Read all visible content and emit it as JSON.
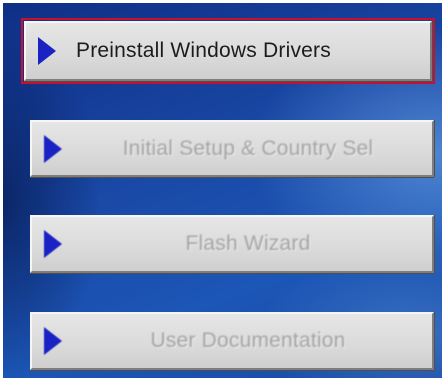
{
  "menu": {
    "buttons": [
      {
        "label": "Preinstall Windows Drivers",
        "state": "active",
        "icon": "play-arrow-icon"
      },
      {
        "label": "Initial Setup & Country Sel",
        "state": "disabled",
        "icon": "play-arrow-icon"
      },
      {
        "label": "Flash Wizard",
        "state": "disabled",
        "icon": "play-arrow-icon"
      },
      {
        "label": "User Documentation",
        "state": "disabled",
        "icon": "play-arrow-icon"
      }
    ]
  },
  "colors": {
    "background": "#1a4aa8",
    "button_face": "#dadada",
    "arrow": "#1a22c4",
    "focus_outline": "#c8102e",
    "disabled_text": "#a2a2a2"
  }
}
